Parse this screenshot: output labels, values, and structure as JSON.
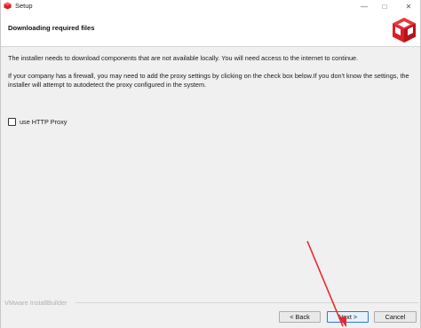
{
  "window": {
    "title": "Setup",
    "controls": {
      "minimize": "—",
      "maximize": "□",
      "close": "✕"
    }
  },
  "header": {
    "title": "Downloading required files",
    "logo_icon": "installer-cube-icon"
  },
  "content": {
    "paragraph1": "The installer needs to download components that are not available locally. You will need access to the internet to continue.",
    "paragraph2": "If your company has a firewall, you may need to add the proxy settings by clicking on the check box below.If you don't know the settings, the installer will attempt to autodetect the proxy configured in the system.",
    "proxy_checkbox": {
      "label": "use HTTP Proxy",
      "checked": false
    }
  },
  "footer": {
    "brand": "VMware InstallBuilder",
    "buttons": {
      "back": "< Back",
      "next": "Next >",
      "cancel": "Cancel"
    }
  },
  "colors": {
    "accent": "#d8202a",
    "annotation_arrow": "#e8282b",
    "focus_border": "#2a7bd4"
  }
}
